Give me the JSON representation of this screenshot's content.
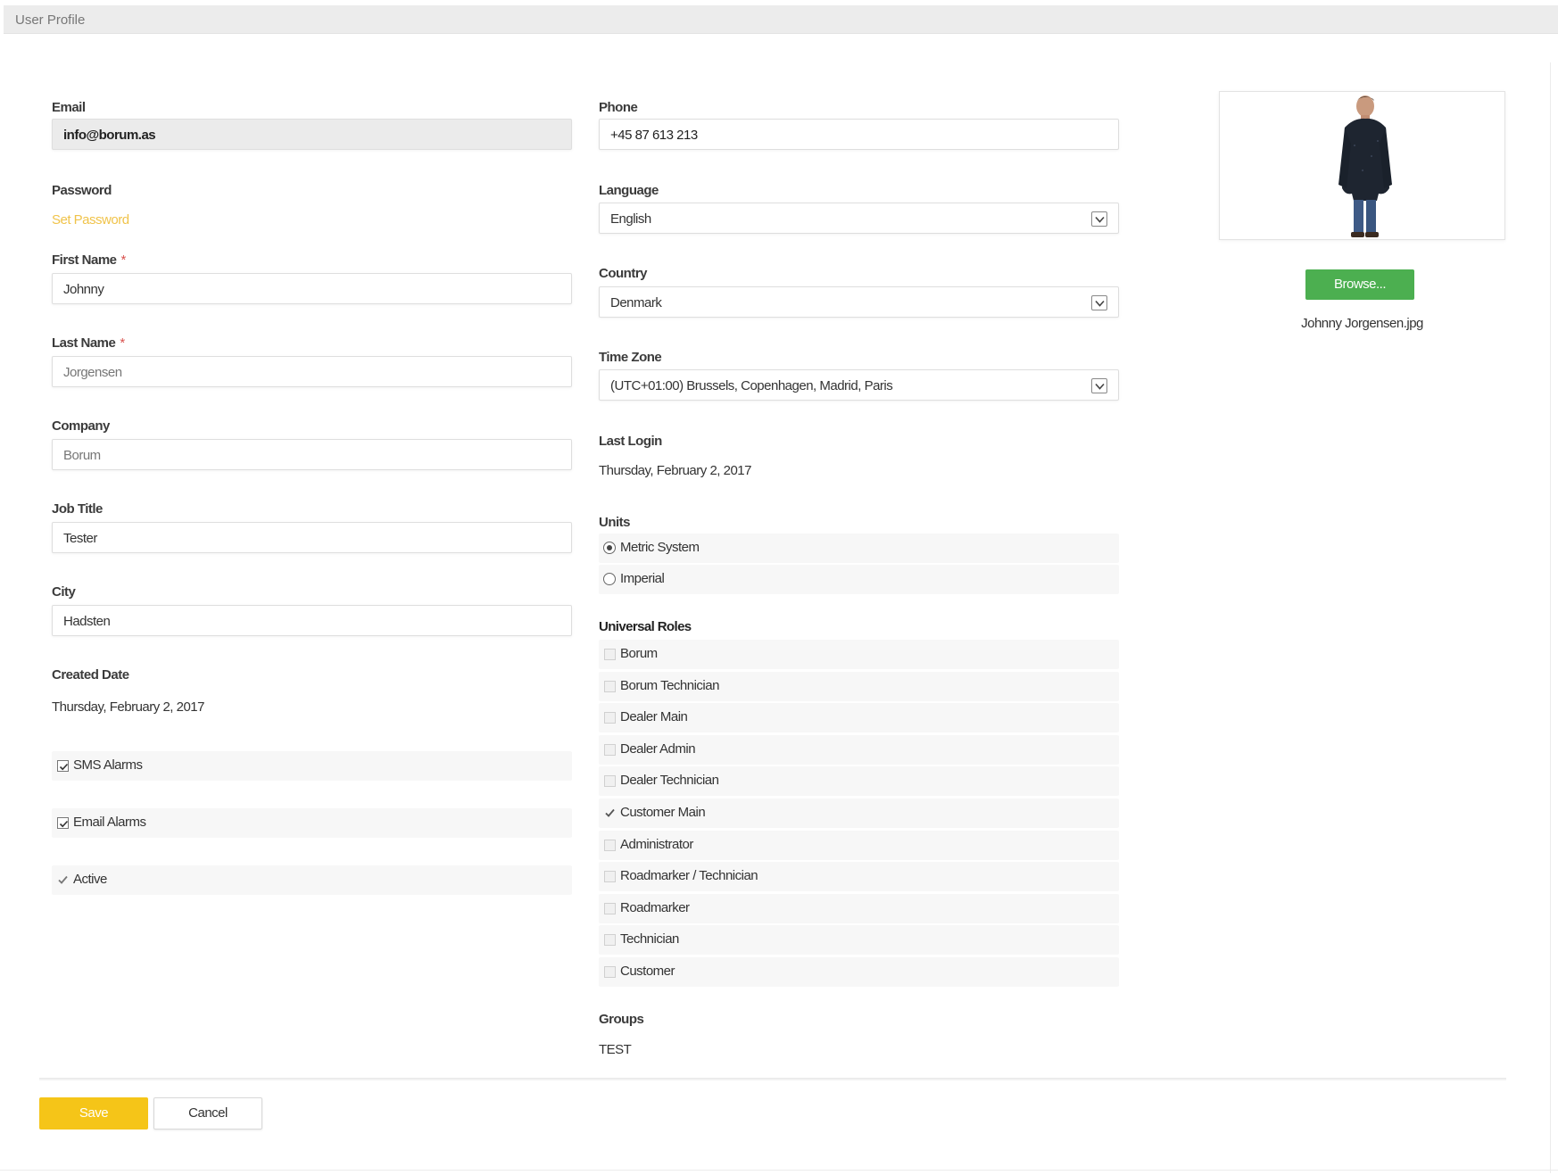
{
  "window": {
    "title": "User Profile"
  },
  "form": {
    "email": {
      "label": "Email",
      "value": "info@borum.as"
    },
    "password": {
      "label": "Password",
      "link": "Set Password"
    },
    "first_name": {
      "label": "First Name",
      "required": "*",
      "value": "Johnny"
    },
    "last_name": {
      "label": "Last Name",
      "required": "*",
      "value": "Jorgensen"
    },
    "company": {
      "label": "Company",
      "value": "Borum"
    },
    "job_title": {
      "label": "Job Title",
      "value": "Tester"
    },
    "city": {
      "label": "City",
      "value": "Hadsten"
    },
    "created_date": {
      "label": "Created Date",
      "value": "Thursday, February 2, 2017"
    },
    "sms_alarms": {
      "label": "SMS Alarms",
      "checked": true
    },
    "email_alarms": {
      "label": "Email Alarms",
      "checked": true
    },
    "active": {
      "label": "Active",
      "checked": true
    },
    "phone": {
      "label": "Phone",
      "value": "+45 87 613 213"
    },
    "language": {
      "label": "Language",
      "value": "English"
    },
    "country": {
      "label": "Country",
      "value": "Denmark"
    },
    "time_zone": {
      "label": "Time Zone",
      "value": "(UTC+01:00) Brussels, Copenhagen, Madrid, Paris"
    },
    "last_login": {
      "label": "Last Login",
      "value": "Thursday, February 2, 2017"
    },
    "units": {
      "label": "Units",
      "options": [
        {
          "label": "Metric System",
          "selected": true
        },
        {
          "label": "Imperial",
          "selected": false
        }
      ]
    },
    "universal_roles": {
      "label": "Universal Roles",
      "items": [
        {
          "label": "Borum",
          "checked": false
        },
        {
          "label": "Borum Technician",
          "checked": false
        },
        {
          "label": "Dealer Main",
          "checked": false
        },
        {
          "label": "Dealer Admin",
          "checked": false
        },
        {
          "label": "Dealer Technician",
          "checked": false
        },
        {
          "label": "Customer Main",
          "checked": true
        },
        {
          "label": "Administrator",
          "checked": false
        },
        {
          "label": "Roadmarker / Technician",
          "checked": false
        },
        {
          "label": "Roadmarker",
          "checked": false
        },
        {
          "label": "Technician",
          "checked": false
        },
        {
          "label": "Customer",
          "checked": false
        }
      ]
    },
    "groups": {
      "label": "Groups",
      "value": "TEST"
    }
  },
  "photo": {
    "browse_label": "Browse...",
    "filename": "Johnny Jorgensen.jpg"
  },
  "footer": {
    "save_label": "Save",
    "cancel_label": "Cancel"
  },
  "colors": {
    "accent_yellow": "#f5c518",
    "browse_green": "#4caf50",
    "required_red": "#d9534f",
    "link_yellow": "#f0c34a"
  }
}
